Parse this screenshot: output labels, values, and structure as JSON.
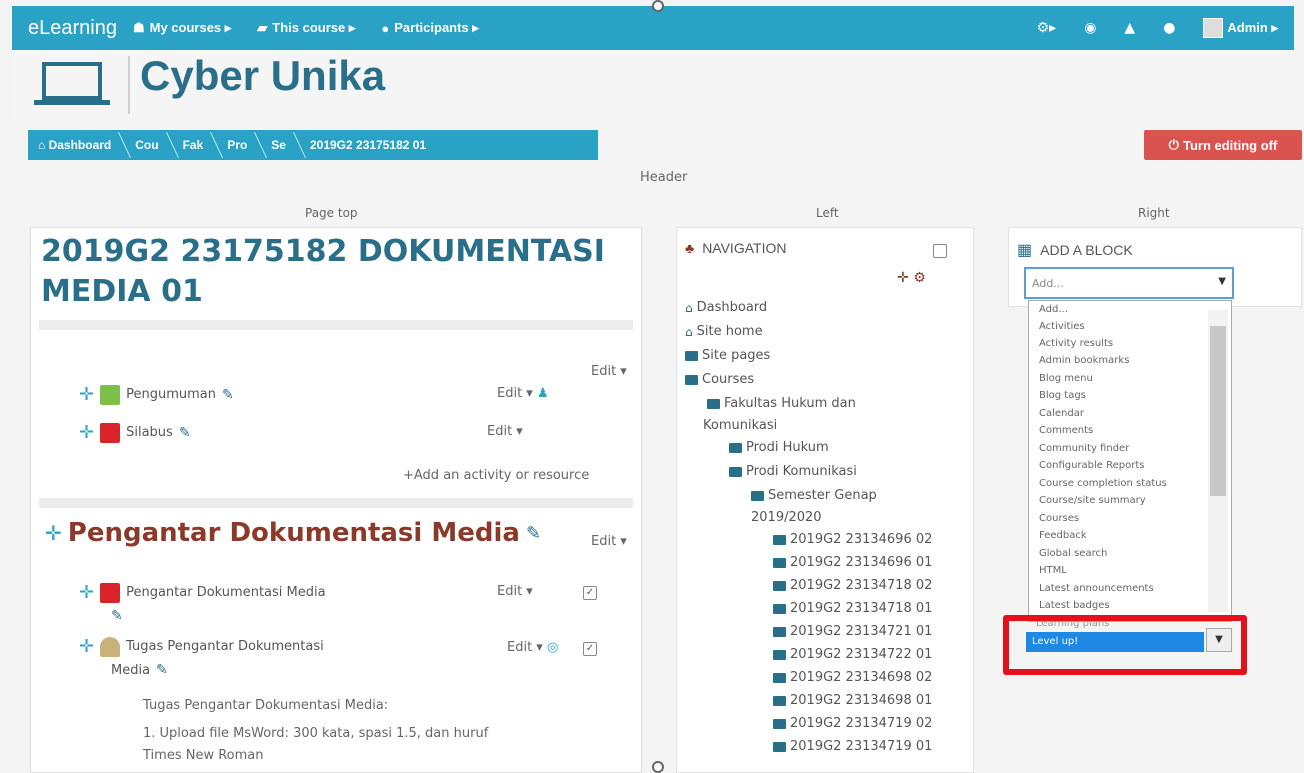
{
  "navbar": {
    "brand": "eLearning",
    "items": [
      {
        "icon": "briefcase-icon",
        "glyph": "☗",
        "label": "My courses ▸"
      },
      {
        "icon": "book-icon",
        "glyph": "▰",
        "label": "This course ▸"
      },
      {
        "icon": "users-icon",
        "glyph": "●",
        "label": "Participants ▸"
      }
    ],
    "right_icons": [
      "⚙▸",
      "◉",
      "▲",
      "●"
    ],
    "admin": "Admin ▸"
  },
  "site": {
    "title": "Cyber Unika"
  },
  "breadcrumb": [
    "⌂ Dashboard",
    "Cou",
    "Fak",
    "Pro",
    "Se",
    "2019G2 23175182 01"
  ],
  "turn_editing_off": "Turn editing off",
  "labels": {
    "header": "Header",
    "page_top": "Page top",
    "left": "Left",
    "right": "Right"
  },
  "course": {
    "title": "2019G2 23175182 DOKUMENTASI MEDIA 01",
    "edit": "Edit ▾",
    "activities_top": [
      {
        "name": "Pengumuman",
        "edit": "Edit ▾"
      },
      {
        "name": "Silabus",
        "edit": "Edit ▾"
      }
    ],
    "add_activity": "+Add an activity or resource",
    "section_title": "Pengantar Dokumentasi Media",
    "section_edit": "Edit ▾",
    "section_activities": [
      {
        "name": "Pengantar Dokumentasi Media",
        "edit": "Edit ▾"
      },
      {
        "name": "Tugas Pengantar Dokumentasi",
        "name2": "Media",
        "edit": "Edit ▾"
      }
    ],
    "desc_title": "Tugas Pengantar Dokumentasi Media:",
    "desc_line1": "1. Upload file MsWord: 300 kata, spasi 1.5, dan huruf",
    "desc_line2": "Times New Roman"
  },
  "navigation": {
    "title": "NAVIGATION",
    "items": [
      "Dashboard",
      "Site home",
      "Site pages",
      "Courses",
      "Fakultas Hukum dan",
      "Komunikasi",
      "Prodi Hukum",
      "Prodi Komunikasi",
      "Semester Genap",
      "2019/2020"
    ],
    "courses": [
      "2019G2 23134696 02",
      "2019G2 23134696 01",
      "2019G2 23134718 02",
      "2019G2 23134718 01",
      "2019G2 23134721 01",
      "2019G2 23134722 01",
      "2019G2 23134698 02",
      "2019G2 23134698 01",
      "2019G2 23134719 02",
      "2019G2 23134719 01"
    ]
  },
  "add_block": {
    "title": "ADD A BLOCK",
    "placeholder": "Add...",
    "options": [
      "Add...",
      "Activities",
      "Activity results",
      "Admin bookmarks",
      "Blog menu",
      "Blog tags",
      "Calendar",
      "Comments",
      "Community finder",
      "Configurable Reports",
      "Course completion status",
      "Course/site summary",
      "Courses",
      "Feedback",
      "Global search",
      "HTML",
      "Latest announcements",
      "Latest badges"
    ],
    "peek": "Learning plans",
    "selected": "Level up!"
  },
  "colors": {
    "bar": "#29a2c6",
    "title": "#2a6f89",
    "section": "#8b3a2a",
    "danger": "#d9534f",
    "highlight": "#e3111b"
  }
}
